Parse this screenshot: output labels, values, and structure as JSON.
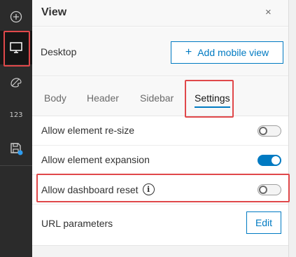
{
  "rail": {
    "items": [
      {
        "name": "add-icon"
      },
      {
        "name": "desktop-icon"
      },
      {
        "name": "theme-icon"
      },
      {
        "name": "number-icon",
        "label": "123"
      },
      {
        "name": "save-icon"
      }
    ]
  },
  "panel": {
    "title": "View",
    "close_icon": "×",
    "mode": {
      "label": "Desktop",
      "add_button": "Add mobile view",
      "add_glyph": "+"
    },
    "tabs": [
      {
        "label": "Body"
      },
      {
        "label": "Header"
      },
      {
        "label": "Sidebar"
      },
      {
        "label": "Settings"
      }
    ],
    "options": [
      {
        "label": "Allow element re-size",
        "enabled": false
      },
      {
        "label": "Allow element expansion",
        "enabled": true
      },
      {
        "label": "Allow dashboard reset",
        "enabled": false,
        "info": "i"
      },
      {
        "label": "URL parameters",
        "button": "Edit"
      }
    ]
  },
  "colors": {
    "accent": "#007ac2",
    "highlight": "#e0484a",
    "rail": "#2b2b2b"
  }
}
